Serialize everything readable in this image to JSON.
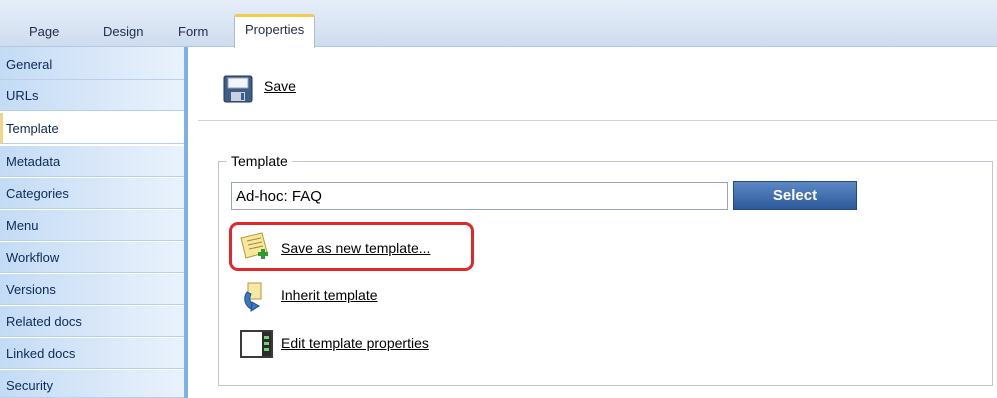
{
  "tabs": [
    {
      "label": "Page"
    },
    {
      "label": "Design"
    },
    {
      "label": "Form"
    },
    {
      "label": "Properties",
      "active": true
    }
  ],
  "sidebar": {
    "items": [
      {
        "label": "General"
      },
      {
        "label": "URLs"
      },
      {
        "label": "Template",
        "selected": true
      },
      {
        "label": "Metadata"
      },
      {
        "label": "Categories"
      },
      {
        "label": "Menu"
      },
      {
        "label": "Workflow"
      },
      {
        "label": "Versions"
      },
      {
        "label": "Related docs"
      },
      {
        "label": "Linked docs"
      },
      {
        "label": "Security"
      }
    ]
  },
  "toolbar": {
    "save_label": "Save",
    "save_icon": "floppy-disk-icon"
  },
  "template": {
    "legend": "Template",
    "value": "Ad-hoc: FAQ",
    "select_label": "Select",
    "actions": [
      {
        "label": "Save as new template...",
        "icon": "save-template-icon"
      },
      {
        "label": "Inherit template",
        "icon": "inherit-template-icon"
      },
      {
        "label": "Edit template properties",
        "icon": "edit-properties-icon"
      }
    ]
  },
  "colors": {
    "highlight": "#e0282a",
    "button": "#2e5a9a",
    "active_tab_accent": "#f5c94b"
  }
}
